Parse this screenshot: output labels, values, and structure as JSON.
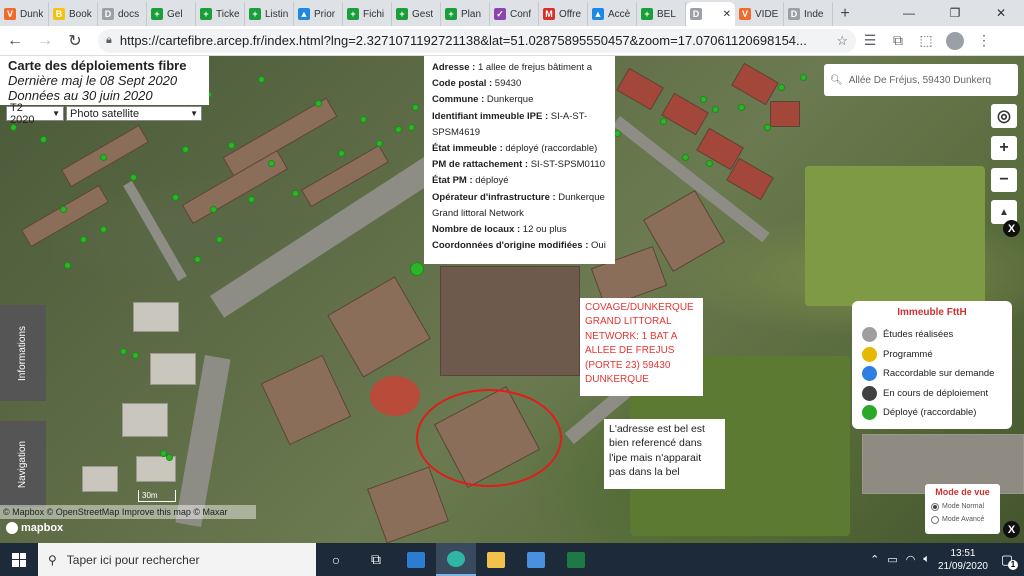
{
  "browser": {
    "tabs": [
      {
        "label": "Dunk",
        "favicon": "V",
        "color": "#f06a2a"
      },
      {
        "label": "Book",
        "favicon": "B",
        "color": "#f4c20d"
      },
      {
        "label": "docs",
        "favicon": "D",
        "color": "#9aa0a6"
      },
      {
        "label": "Gel",
        "favicon": "+",
        "color": "#1a9e3a"
      },
      {
        "label": "Ticke",
        "favicon": "+",
        "color": "#1a9e3a"
      },
      {
        "label": "Listin",
        "favicon": "+",
        "color": "#1a9e3a"
      },
      {
        "label": "Prior",
        "favicon": "▲",
        "color": "#1e88e5"
      },
      {
        "label": "Fichi",
        "favicon": "+",
        "color": "#1a9e3a"
      },
      {
        "label": "Gest",
        "favicon": "+",
        "color": "#1a9e3a"
      },
      {
        "label": "Plan",
        "favicon": "+",
        "color": "#1a9e3a"
      },
      {
        "label": "Conf",
        "favicon": "✓",
        "color": "#8e44ad"
      },
      {
        "label": "Offre",
        "favicon": "M",
        "color": "#d93025"
      },
      {
        "label": "Accè",
        "favicon": "▲",
        "color": "#1e88e5"
      },
      {
        "label": "BEL",
        "favicon": "+",
        "color": "#1a9e3a"
      },
      {
        "label": "",
        "favicon": "D",
        "color": "#9aa0a6",
        "active": true
      },
      {
        "label": "VIDE",
        "favicon": "V",
        "color": "#f06a2a"
      },
      {
        "label": "Inde",
        "favicon": "D",
        "color": "#9aa0a6"
      }
    ],
    "new_tab": "+",
    "window_controls": {
      "minimize": "—",
      "restore": "❐",
      "close": "✕"
    },
    "url": "https://cartefibre.arcep.fr/index.html?lng=2.3271071192721138&lat=51.02875895550457&zoom=17.07061120698154..."
  },
  "map": {
    "title": "Carte des déploiements fibre",
    "updated": "Dernière maj le 08 Sept 2020",
    "data_date": "Données au 30 juin 2020",
    "period_select": "T2 2020",
    "layer_select": "Photo satellite",
    "search_value": "Allée De Fréjus, 59430 Dunkerq",
    "zoom_in": "+",
    "zoom_out": "−",
    "reset_north": "▲",
    "close_symbol": "X",
    "scale": "30m",
    "attribution": "© Mapbox © OpenStreetMap Improve this map © Maxar",
    "mapbox_logo": "mapbox",
    "side_tabs": {
      "informations": "Informations",
      "navigation": "Navigation"
    }
  },
  "popup": [
    {
      "label": "Adresse :",
      "value": " 1 allee de frejus bâtiment a"
    },
    {
      "label": "Code postal :",
      "value": " 59430"
    },
    {
      "label": "Commune :",
      "value": " Dunkerque"
    },
    {
      "label": "Identifiant immeuble IPE :",
      "value": " SI-A-ST-SPSM4619"
    },
    {
      "label": "État immeuble :",
      "value": " déployé (raccordable)"
    },
    {
      "label": "PM de rattachement :",
      "value": " SI-ST-SPSM0110"
    },
    {
      "label": "État PM :",
      "value": " déployé"
    },
    {
      "label": "Opérateur d'infrastructure :",
      "value": " Dunkerque Grand littoral Network"
    },
    {
      "label": "Nombre de locaux :",
      "value": " 12 ou plus"
    },
    {
      "label": "Coordonnées d'origine modifiées :",
      "value": " Oui"
    }
  ],
  "legend": {
    "title": "Immeuble FttH",
    "items": [
      {
        "label": "Études réalisées",
        "color": "#9e9e9e"
      },
      {
        "label": "Programmé",
        "color": "#e6b800"
      },
      {
        "label": "Raccordable sur demande",
        "color": "#2f7fe0"
      },
      {
        "label": "En cours de déploiement",
        "color": "#404040"
      },
      {
        "label": "Déployé (raccordable)",
        "color": "#2aa82a"
      }
    ]
  },
  "view_mode": {
    "title": "Mode de vue",
    "options": [
      {
        "label": "Mode Normal",
        "selected": true
      },
      {
        "label": "Mode Avancé",
        "selected": false
      }
    ]
  },
  "annotations": {
    "covage": "COVAGE/DUNKERQUE GRAND LITTORAL NETWORK: 1 BAT A ALLEE DE FREJUS (PORTE 23) 59430 DUNKERQUE",
    "ipe_note": "L'adresse est bel est bien referencé dans l'ipe mais n'apparait pas dans la bel"
  },
  "taskbar": {
    "search_placeholder": "Taper ici pour rechercher",
    "time": "13:51",
    "date": "21/09/2020",
    "notification_count": "1"
  }
}
